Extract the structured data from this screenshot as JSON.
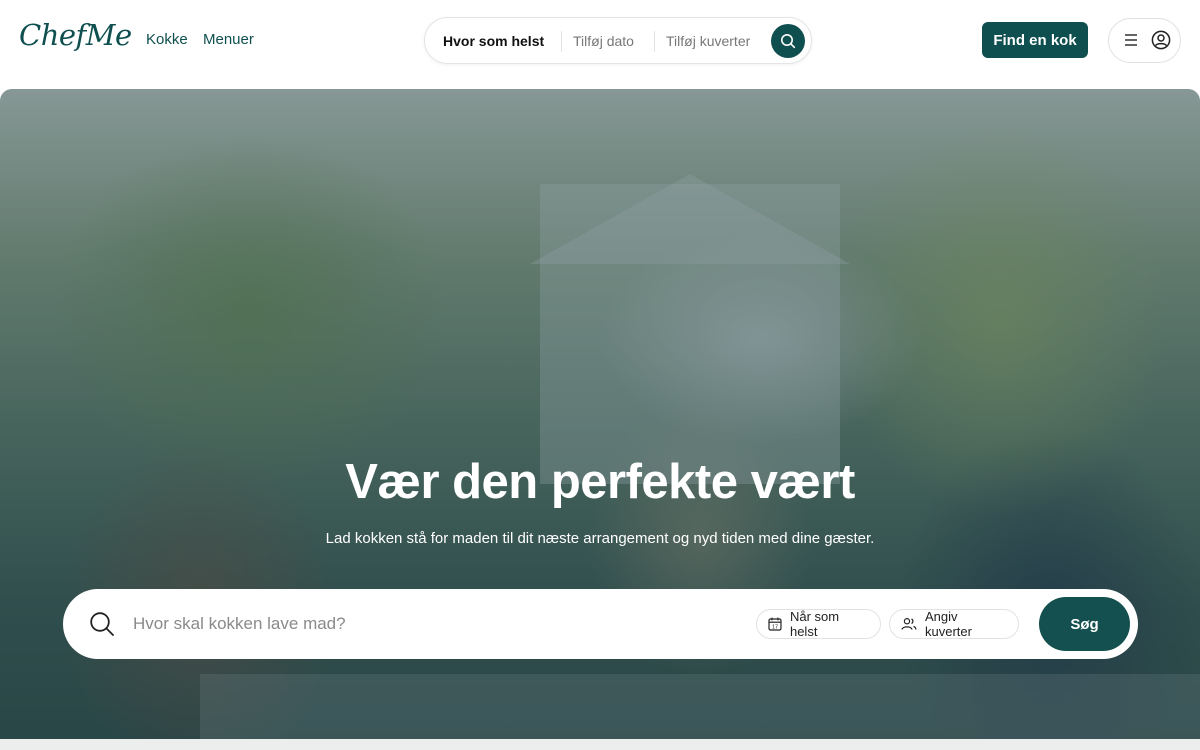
{
  "header": {
    "logo": "ChefMe",
    "nav": [
      {
        "label": "Kokke"
      },
      {
        "label": "Menuer"
      }
    ],
    "search_pill": {
      "where": "Hvor som helst",
      "date": "Tilføj dato",
      "guests": "Tilføj kuverter"
    },
    "cta_label": "Find en kok",
    "icons": {
      "search": "search-icon",
      "menu": "hamburger-icon",
      "account": "user-circle-icon"
    }
  },
  "hero": {
    "title": "Vær den perfekte vært",
    "subtitle": "Lad kokken stå for maden til dit næste arrangement og nyd tiden med dine gæster.",
    "search": {
      "placeholder": "Hvor skal kokken lave mad?",
      "date_chip": "Når som helst",
      "guests_chip": "Angiv kuverter",
      "submit_label": "Søg"
    }
  },
  "colors": {
    "brand": "#0f4f4f",
    "text": "#111111",
    "muted": "#777777"
  }
}
